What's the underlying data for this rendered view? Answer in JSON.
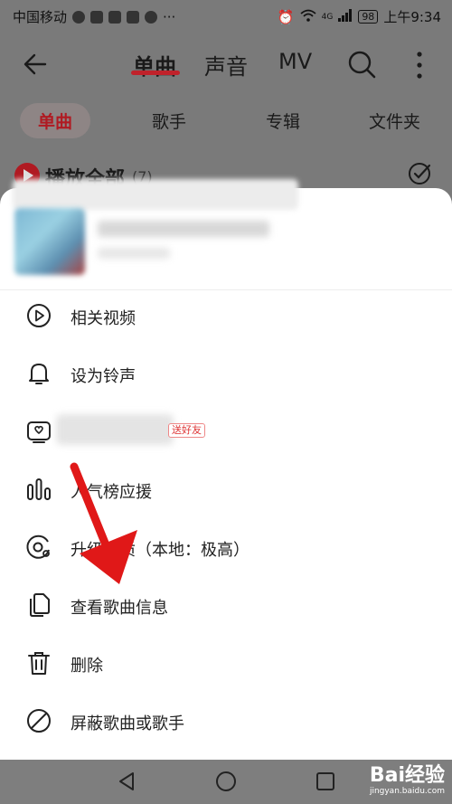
{
  "status_bar": {
    "carrier": "中国移动",
    "network": "4G",
    "battery": "98",
    "time": "上午9:34"
  },
  "topbar": {
    "tabs": [
      "单曲",
      "声音",
      "MV"
    ],
    "active_tab": "单曲"
  },
  "subtabs": [
    "单曲",
    "歌手",
    "专辑",
    "文件夹"
  ],
  "play_all": {
    "label": "播放全部",
    "count": "(7)"
  },
  "menu": {
    "items": [
      {
        "label": "相关视频",
        "icon": "play-video-icon"
      },
      {
        "label": "设为铃声",
        "icon": "bell-icon"
      },
      {
        "label": "",
        "icon": "share-card-icon",
        "badge": "送好友"
      },
      {
        "label": "人气榜应援",
        "icon": "bar-chart-icon"
      },
      {
        "label": "升级音质（本地：极高）",
        "icon": "disc-icon"
      },
      {
        "label": "查看歌曲信息",
        "icon": "document-copy-icon"
      },
      {
        "label": "删除",
        "icon": "trash-icon"
      },
      {
        "label": "屏蔽歌曲或歌手",
        "icon": "block-icon"
      }
    ]
  },
  "watermark": {
    "brand": "Bai经验",
    "url": "jingyan.baidu.com"
  },
  "colors": {
    "accent": "#c0222b",
    "overlay": "#7a7a7a",
    "arrow": "#e01818"
  }
}
